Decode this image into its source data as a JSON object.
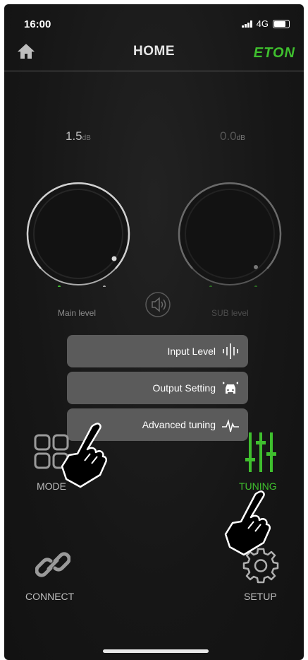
{
  "status": {
    "time": "16:00",
    "network": "4G"
  },
  "header": {
    "title": "HOME",
    "brand": "ETON"
  },
  "levels": {
    "main": {
      "value": "1.5",
      "unit": "dB",
      "label": "Main level"
    },
    "sub": {
      "value": "0.0",
      "unit": "dB",
      "label": "SUB level"
    }
  },
  "menu": {
    "input_level": "Input Level",
    "output_setting": "Output Setting",
    "advanced_tuning": "Advanced tuning"
  },
  "nav": {
    "mode": "MODE",
    "tuning": "TUNING",
    "connect": "CONNECT",
    "setup": "SETUP"
  },
  "colors": {
    "accent": "#3fbf2e",
    "menu_bg": "#5b5b5b",
    "screen_bg": "#161616"
  }
}
